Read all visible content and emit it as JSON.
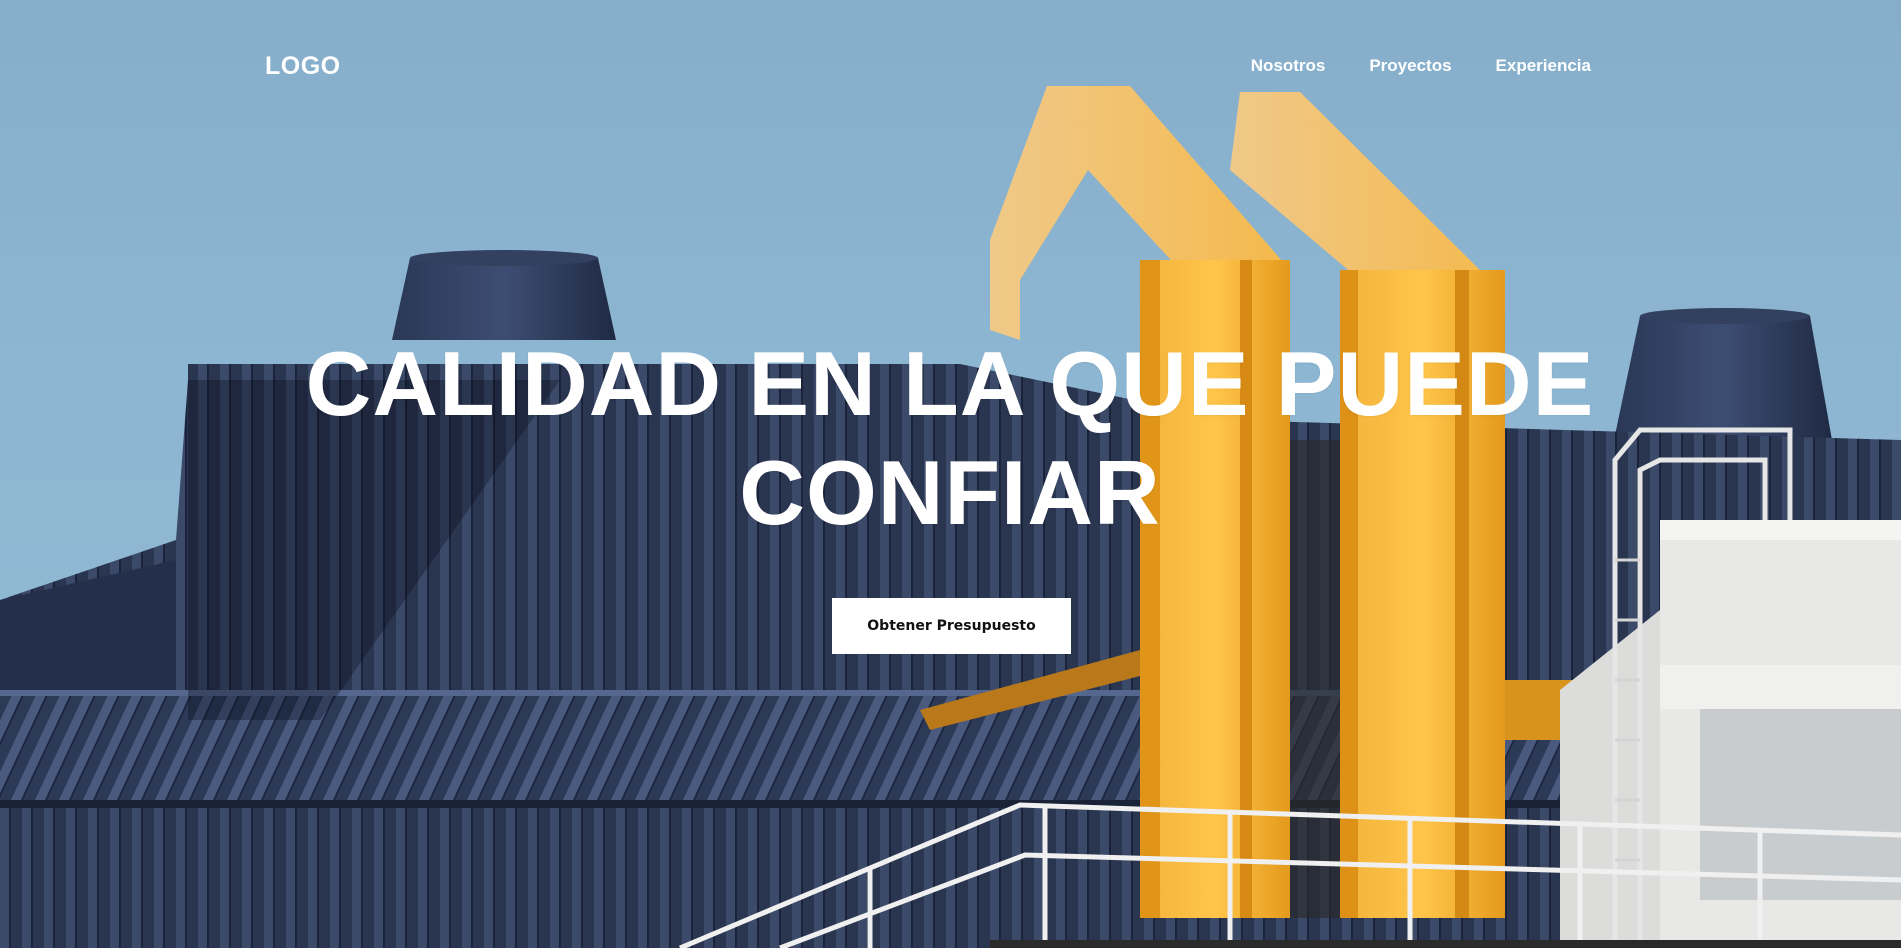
{
  "header": {
    "logo": "LOGO",
    "nav": [
      {
        "label": "Nosotros"
      },
      {
        "label": "Proyectos"
      },
      {
        "label": "Experiencia"
      }
    ]
  },
  "hero": {
    "title_line1": "CALIDAD EN LA QUE PUEDE",
    "title_line2": "CONFIAR",
    "cta_label": "Obtener Presupuesto"
  }
}
